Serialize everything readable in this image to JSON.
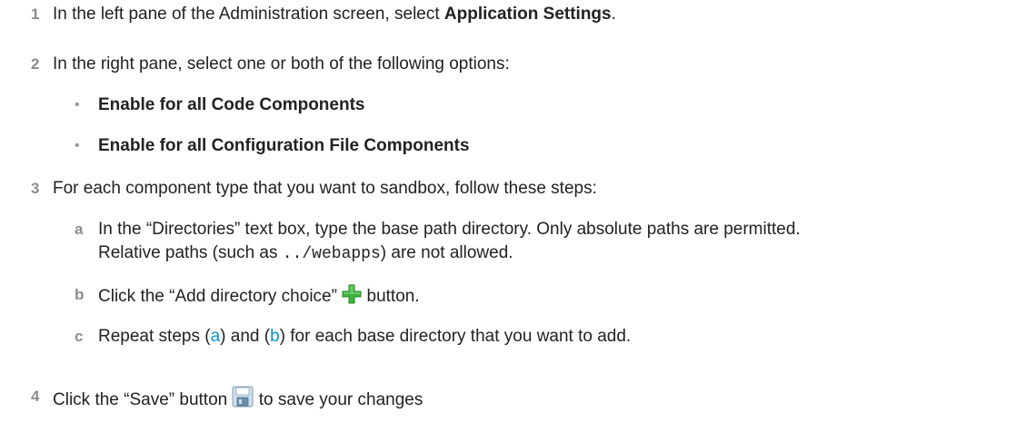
{
  "steps": [
    {
      "number": "1",
      "text_before": "In the left pane of the Administration screen, select ",
      "bold": "Application Settings",
      "text_after": "."
    },
    {
      "number": "2",
      "text": "In the right pane, select one or both of the following options:",
      "bullets": [
        "Enable for all Code Components",
        "Enable for all Configuration File Components"
      ]
    },
    {
      "number": "3",
      "text": "For each component type that you want to sandbox, follow these steps:",
      "substeps": [
        {
          "letter": "a",
          "line1": "In the “Directories” text box, type the base path directory. Only absolute paths are permitted.",
          "line2_before": "Relative paths (such as ",
          "code": "../webapps",
          "line2_after": ") are not allowed."
        },
        {
          "letter": "b",
          "text_before": "Click the “Add directory choice” ",
          "icon": "add-plus-icon",
          "text_after": " button."
        },
        {
          "letter": "c",
          "text_1": "Repeat steps (",
          "ref_a": "a",
          "text_2": ") and (",
          "ref_b": "b",
          "text_3": ") for each base directory that you want to add."
        }
      ]
    },
    {
      "number": "4",
      "text_before": "Click the “Save” button ",
      "icon": "save-floppy-icon",
      "text_after": " to save your changes"
    }
  ],
  "colors": {
    "step_number": "#8c8c8c",
    "link": "#0096d6",
    "plus_icon": "#3cb43c"
  }
}
